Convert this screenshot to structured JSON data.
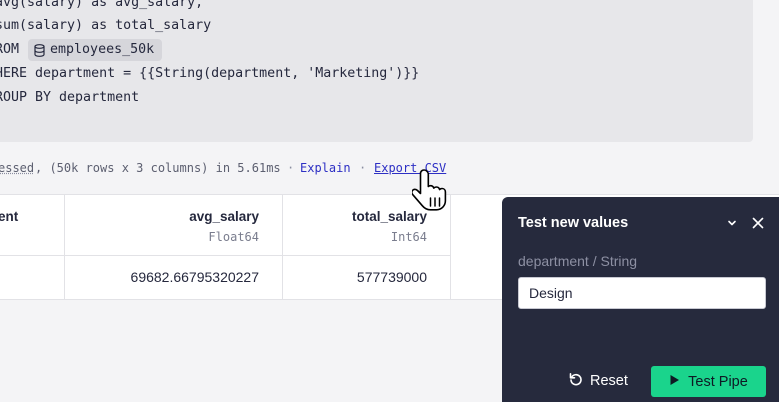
{
  "editor": {
    "lines": [
      "avg(salary) as avg_salary,",
      "sum(salary) as total_salary",
      "ROM",
      "HERE department = {{String(department, 'Marketing')}}",
      "ROUP BY department"
    ],
    "table_name": "employees_50k"
  },
  "stats": {
    "processed": "essed",
    "details": ", (50k rows x 3 columns) in 5.61ms",
    "separator": "·",
    "explain_label": "Explain",
    "export_label": "Export CSV"
  },
  "results": {
    "columns": [
      {
        "name": "ent",
        "type": ""
      },
      {
        "name": "avg_salary",
        "type": "Float64"
      },
      {
        "name": "total_salary",
        "type": "Int64"
      }
    ],
    "rows": [
      {
        "cells": [
          "",
          "69682.66795320227",
          "577739000"
        ]
      }
    ]
  },
  "panel": {
    "title": "Test new values",
    "field_label": "department / String",
    "field_value": "Design",
    "reset_label": "Reset",
    "test_label": "Test Pipe"
  },
  "colors": {
    "accent_green": "#1ad48c",
    "panel_bg": "#262a3d",
    "link": "#2d2fc4"
  },
  "icons": [
    "database-icon",
    "hand-pointer-icon",
    "chevron-down-icon",
    "close-icon",
    "reset-icon",
    "play-icon"
  ]
}
